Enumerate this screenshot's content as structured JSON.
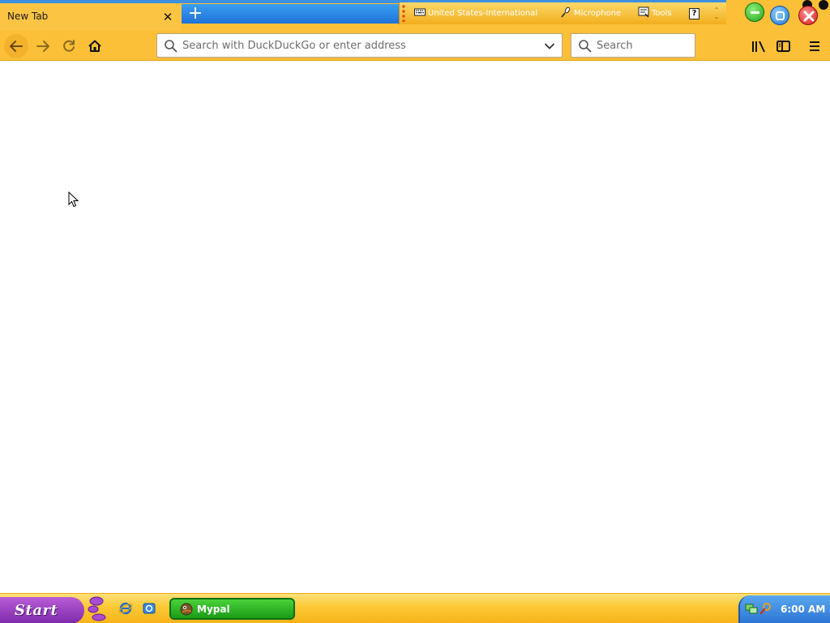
{
  "browser": {
    "tab": {
      "title": "New Tab",
      "close_symbol": "✕"
    },
    "new_tab_symbol": "+",
    "url_bar": {
      "placeholder": "Search with DuckDuckGo or enter address",
      "value": ""
    },
    "search_bar": {
      "placeholder": "Search",
      "value": ""
    }
  },
  "language_bar": {
    "keyboard_label": "United States-International",
    "microphone_label": "Microphone",
    "tools_label": "Tools",
    "help_label": "?"
  },
  "taskbar": {
    "start_label": "Start",
    "task_label": "Mypal",
    "clock": "6:00 AM"
  },
  "icons": {
    "back": "arrow-left-icon",
    "forward": "arrow-right-icon",
    "reload": "reload-icon",
    "home": "home-icon",
    "url_search": "search-icon",
    "url_dropdown": "chevron-down-icon",
    "library": "library-icon",
    "sidebar": "sidebar-icon",
    "menu": "hamburger-menu-icon"
  },
  "colors": {
    "chrome_yellow": "#fbc037",
    "tab_blue": "#3d8fe0",
    "start_purple": "#9b3fc4",
    "task_green": "#2fb324",
    "tray_blue": "#3f8ae0"
  }
}
